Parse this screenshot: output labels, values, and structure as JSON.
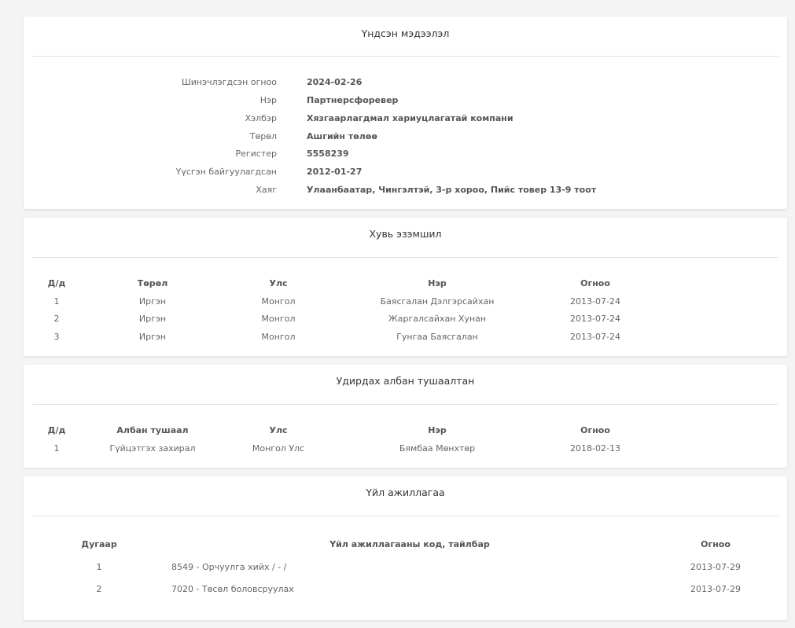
{
  "basic_info": {
    "title": "Үндсэн мэдээлэл",
    "rows": [
      {
        "label": "Шинэчлэгдсэн огноо",
        "value": "2024-02-26"
      },
      {
        "label": "Нэр",
        "value": "Партнерсфоревер"
      },
      {
        "label": "Хэлбэр",
        "value": "Хязгаарлагдмал хариуцлагатай компани"
      },
      {
        "label": "Төрөл",
        "value": "Ашгийн төлөө"
      },
      {
        "label": "Регистер",
        "value": "5558239"
      },
      {
        "label": "Үүсгэн байгуулагдсан",
        "value": "2012-01-27"
      },
      {
        "label": "Хаяг",
        "value": "Улаанбаатар, Чингэлтэй, 3-р хороо, Пийс товер 13-9 тоот"
      }
    ]
  },
  "ownership": {
    "title": "Хувь эзэмшил",
    "headers": [
      "Д/д",
      "Төрөл",
      "Улс",
      "Нэр",
      "Огноо"
    ],
    "rows": [
      [
        "1",
        "Иргэн",
        "Монгол",
        "Баясгалан Дэлгэрсайхан",
        "2013-07-24"
      ],
      [
        "2",
        "Иргэн",
        "Монгол",
        "Жаргалсайхан Хунан",
        "2013-07-24"
      ],
      [
        "3",
        "Иргэн",
        "Монгол",
        "Гунгаа Баясгалан",
        "2013-07-24"
      ]
    ]
  },
  "management": {
    "title": "Удирдах албан тушаалтан",
    "headers": [
      "Д/д",
      "Албан тушаал",
      "Улс",
      "Нэр",
      "Огноо"
    ],
    "rows": [
      [
        "1",
        "Гүйцэтгэх захирал",
        "Монгол Улс",
        "Бямбаа Мөнхтөр",
        "2018-02-13"
      ]
    ]
  },
  "activities": {
    "title": "Үйл ажиллагаа",
    "headers": [
      "Дугаар",
      "Үйл ажиллагааны код, тайлбар",
      "Огноо"
    ],
    "rows": [
      [
        "1",
        "8549 - Орчуулга хийх / - /",
        "2013-07-29"
      ],
      [
        "2",
        "7020 - Төсөл боловсруулах",
        "2013-07-29"
      ]
    ]
  }
}
